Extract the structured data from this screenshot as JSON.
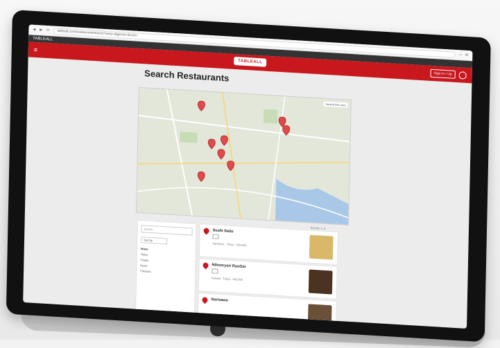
{
  "browser": {
    "url": "tableall.com/restaurant/search?area=&genre=&sort=",
    "tab_label": "TABLEALL"
  },
  "header": {
    "logo_text": "TABLEALL",
    "signin_label": "Sign In / Up",
    "menu_icon": "hamburger-icon",
    "user_icon": "user-icon"
  },
  "page": {
    "title": "Search Restaurants"
  },
  "map": {
    "control_label": "Search this area",
    "marker_count": 10
  },
  "results_meta": {
    "count_text": "Results 1–3"
  },
  "filter": {
    "search_placeholder": "Search...",
    "sort_label": "Sort by",
    "area_heading": "Area",
    "items": [
      "Tokyo",
      "Osaka",
      "Kyoto",
      "Fukuoka"
    ]
  },
  "results": [
    {
      "name": "Sushi Saito",
      "meta": "Japanese · Tokyo · ¥30,000",
      "image_color": "#d9b86a"
    },
    {
      "name": "Nihonryori RyuGin",
      "meta": "Kaiseki · Tokyo · ¥35,000",
      "image_color": "#4a3320"
    },
    {
      "name": "Narisawa",
      "meta": "",
      "image_color": "#6a5038"
    }
  ],
  "colors": {
    "brand_red": "#c8181e"
  }
}
